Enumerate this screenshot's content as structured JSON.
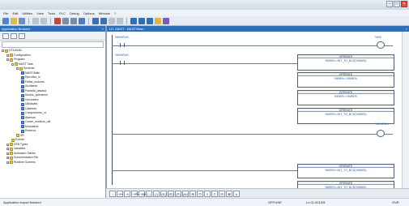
{
  "window": {
    "title": "",
    "controls": {
      "minimize": "–",
      "maximize": "□",
      "close": "×"
    }
  },
  "menu": [
    "File",
    "Edit",
    "Utilities",
    "View",
    "Tools",
    "PLC",
    "Debug",
    "Options",
    "Window",
    "?"
  ],
  "browser": {
    "title": "Application Browser",
    "search_placeholder": "",
    "tree": [
      {
        "label": "UTILIDAD",
        "indent": 0
      },
      {
        "label": "Configuration",
        "indent": 1
      },
      {
        "label": "Program",
        "indent": 1
      },
      {
        "label": "MAST Task",
        "indent": 2
      },
      {
        "label": "Sections",
        "indent": 3
      },
      {
        "label": "MAST/Main",
        "indent": 4
      },
      {
        "label": "Ejecutivo_io",
        "indent": 4
      },
      {
        "label": "Fallas_motores",
        "indent": 4
      },
      {
        "label": "Auxiliares",
        "indent": 4
      },
      {
        "label": "Pantalla_pasada",
        "indent": 4
      },
      {
        "label": "Modos_operacion",
        "indent": 4
      },
      {
        "label": "Horometro",
        "indent": 4
      },
      {
        "label": "Utilidades",
        "indent": 4
      },
      {
        "label": "Calderas",
        "indent": 4
      },
      {
        "label": "Compresores_or",
        "indent": 4
      },
      {
        "label": "Alarmas",
        "indent": 4
      },
      {
        "label": "Comm_modbus_util",
        "indent": 4
      },
      {
        "label": "Modulares",
        "indent": 4
      },
      {
        "label": "Reserva",
        "indent": 4
      },
      {
        "label": "SR",
        "indent": 3
      },
      {
        "label": "Events",
        "indent": 2
      },
      {
        "label": "DFB Types",
        "indent": 1
      },
      {
        "label": "Variables",
        "indent": 1
      },
      {
        "label": "Animation Tables",
        "indent": 1
      },
      {
        "label": "Documentation File",
        "indent": 1
      },
      {
        "label": "Runtime Screens",
        "indent": 1
      }
    ]
  },
  "editor": {
    "title": "LD: MAST : MAST/Main",
    "contacts": [
      {
        "label": "%M%RUN"
      },
      {
        "label": "%M%RUN"
      }
    ],
    "coils": [
      {
        "label": "%M0"
      },
      {
        "label": "%M%RUN"
      }
    ],
    "operate_blocks": [
      {
        "header": "OPERATE",
        "expr": "%MW%:=INT_TO_BCD(%MW0);"
      },
      {
        "header": "OPERATE",
        "expr": "%MW%:=%MW%;"
      },
      {
        "header": "OPERATE",
        "expr": "%MW%:=%MW%;"
      },
      {
        "header": "OPERATE",
        "expr": "%MW%:=INT_TO_BCD(%MW0);"
      },
      {
        "header": "OPERATE",
        "expr": "%MW%:=INT_TO_BCD(%MW0);"
      },
      {
        "header": "OPERATE",
        "expr": "%MW%:=INT_TO_BCD(%MW0);"
      }
    ],
    "bottom_tools": [
      "↑",
      "⊣⊢",
      "⊣/⊢",
      "⊣P⊢",
      "⊣N⊢",
      "( )",
      "(/)",
      "(S)",
      "(R)",
      "(P)",
      "(N)",
      "⊞",
      "⊡",
      "≡",
      "⎍",
      "⊟",
      "⊠",
      "↳"
    ]
  },
  "status": {
    "left": "Application export finished",
    "mode": "OFFLINE",
    "address": "Lo 01.0019/5",
    "ovr": "OVR"
  }
}
